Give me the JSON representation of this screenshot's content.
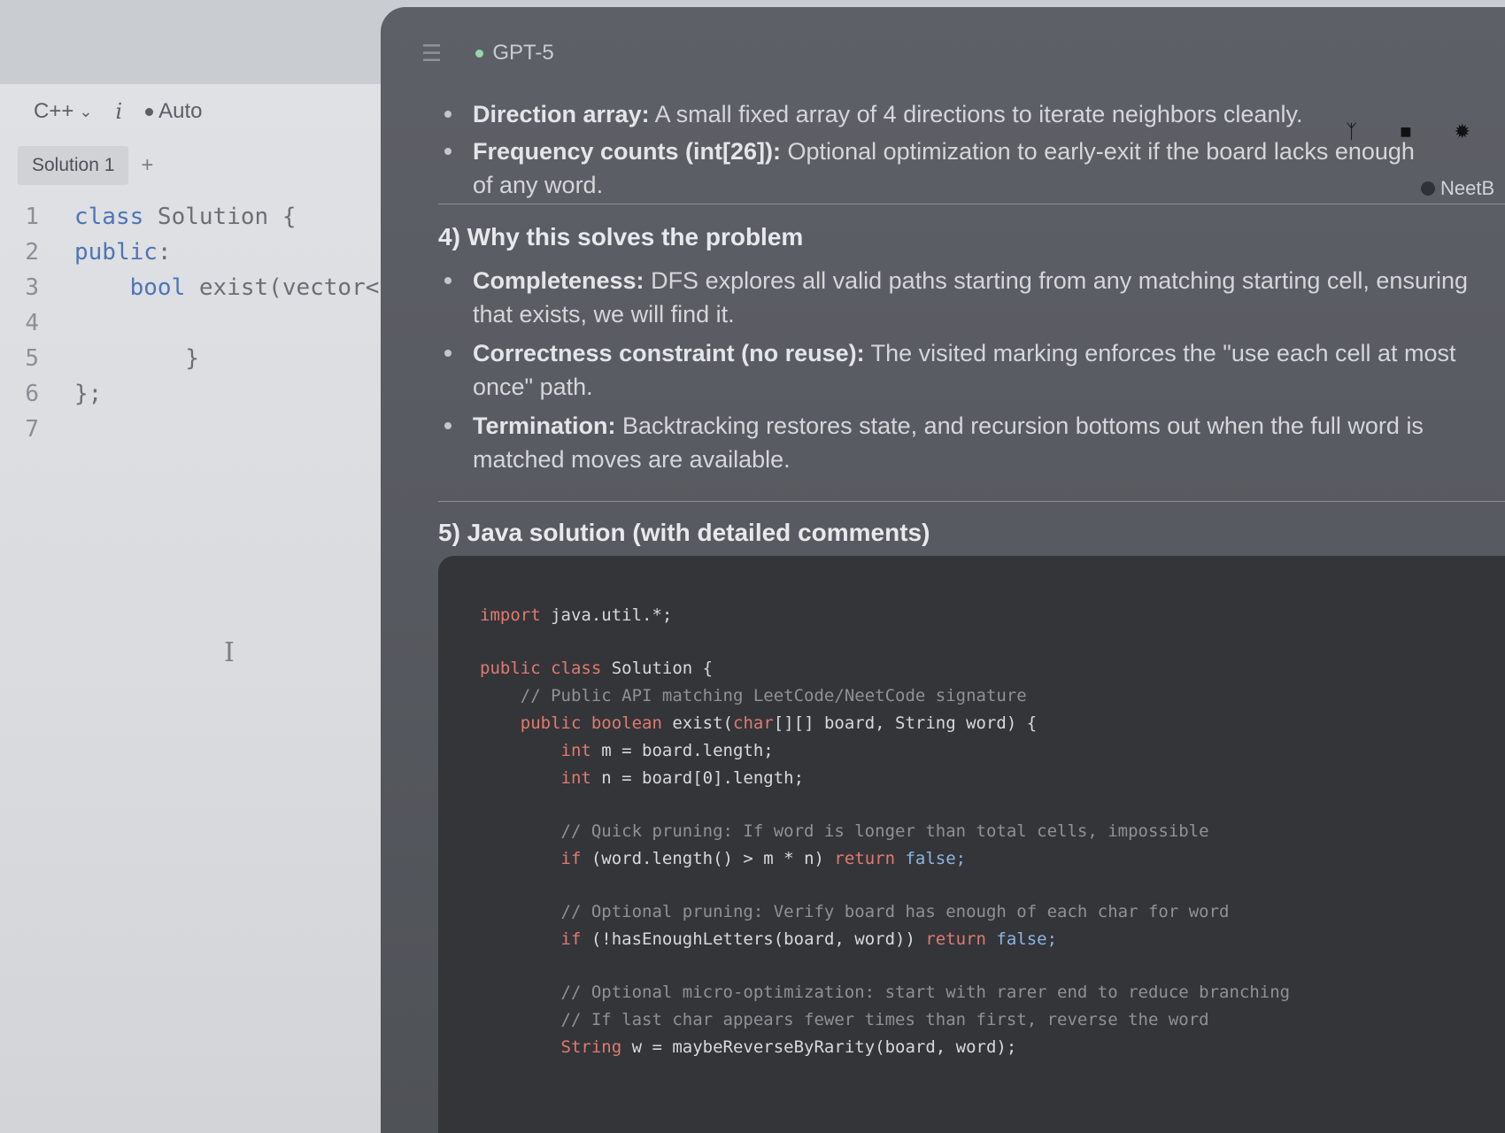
{
  "editor": {
    "language": "C++",
    "info_icon": "info-italic-icon",
    "mode": "Auto",
    "tabs": [
      {
        "label": "Solution 1"
      }
    ],
    "add_tab": "+",
    "code_lines": [
      {
        "n": "1",
        "kw": "class",
        "rest": " Solution {",
        "indent": ""
      },
      {
        "n": "2",
        "kw": "public",
        "rest": ":",
        "indent": ""
      },
      {
        "n": "3",
        "kw": "bool",
        "rest": " exist(vector<vector<char>>& board, string word) {",
        "indent": "    "
      },
      {
        "n": "4",
        "kw": "",
        "rest": "",
        "indent": ""
      },
      {
        "n": "5",
        "kw": "",
        "rest": "}",
        "indent": "        "
      },
      {
        "n": "6",
        "kw": "",
        "rest": "};",
        "indent": ""
      },
      {
        "n": "7",
        "kw": "",
        "rest": "",
        "indent": ""
      }
    ]
  },
  "chat": {
    "menu_icon": "hamburger-menu-icon",
    "model": "GPT-5",
    "bullets_top": [
      {
        "label": "Direction array:",
        "text": " A small fixed array of 4 directions to iterate neighbors cleanly."
      },
      {
        "label": "Frequency counts (int[26]):",
        "text": " Optional optimization to early-exit if the board lacks enough of any word."
      }
    ],
    "neet_label": "NeetB",
    "section4_heading": "4) Why this solves the problem",
    "bullets_why": [
      {
        "label": "Completeness:",
        "text": " DFS explores all valid paths starting from any matching starting cell, ensuring that exists, we will find it."
      },
      {
        "label": "Correctness constraint (no reuse):",
        "text": " The visited marking enforces the \"use each cell at most once\" path."
      },
      {
        "label": "Termination:",
        "text": " Backtracking restores state, and recursion bottoms out when the full word is matched moves are available."
      }
    ],
    "section5_heading": "5) Java solution (with detailed comments)",
    "java_code": {
      "import_kw": "import",
      "import_rest": " java.util.*;",
      "class_kw": "public class",
      "class_rest": " Solution {",
      "comment_api": "// Public API matching LeetCode/NeetCode signature",
      "method_kw": "public boolean",
      "method_rest_a": " exist(",
      "method_type": "char",
      "method_rest_b": "[][] board, String word) {",
      "m_kw": "int",
      "m_rest": " m = board.length;",
      "n_kw": "int",
      "n_rest": " n = board[0].length;",
      "comment_prune1": "// Quick pruning: If word is longer than total cells, impossible",
      "if1_kw": "if",
      "if1_rest": " (word.length() > m * n) ",
      "if1_ret": "return",
      "if1_val": " false;",
      "comment_prune2": "// Optional pruning: Verify board has enough of each char for word",
      "if2_kw": "if",
      "if2_rest": " (!hasEnoughLetters(board, word)) ",
      "if2_ret": "return",
      "if2_val": " false;",
      "comment_micro1": "// Optional micro-optimization: start with rarer end to reduce branching",
      "comment_micro2": "// If last char appears fewer times than first, reverse the word",
      "str_kw": "String",
      "str_rest": " w = maybeReverseByRarity(board, word);"
    }
  },
  "colors": {
    "keyword_blue": "#4f74b8",
    "code_keyword_red": "#e07a6f",
    "chat_bg": "#585b61",
    "editor_bg": "#dfe1e4"
  }
}
